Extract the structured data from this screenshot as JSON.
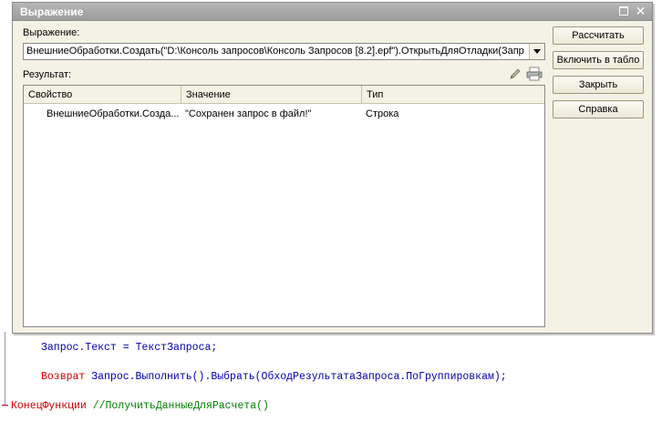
{
  "editor": {
    "line1": {
      "object": "Запрос",
      "property": "Текст",
      "op": " = ",
      "value": "ТекстЗапроса",
      "end": ";"
    },
    "line2": {
      "keyword": "Возврат",
      "call": "Запрос.Выполнить().Выбрать(ОбходРезультатаЗапроса.ПоГруппировкам);"
    },
    "line3": {
      "keyword": "КонецФункции",
      "comment": " //ПолучитьДанныеДляРасчета()"
    }
  },
  "dialog": {
    "title": "Выражение",
    "expression_label": "Выражение:",
    "expression_value": "ВнешниеОбработки.Создать(\"D:\\Консоль запросов\\Консоль Запросов [8.2].epf\").ОткрытьДляОтладки(Запр",
    "result_label": "Результат:",
    "icons": {
      "edit": "pencil-icon",
      "print": "print-icon"
    },
    "table": {
      "headers": [
        "Свойство",
        "Значение",
        "Тип"
      ],
      "rows": [
        {
          "property": "ВнешниеОбработки.Созда...",
          "value": "\"Сохранен запрос в файл!\"",
          "type": "Строка"
        }
      ]
    },
    "buttons": {
      "calculate": "Рассчитать",
      "include_in_table": "Включить в табло",
      "close": "Закрыть",
      "help": "Справка"
    }
  },
  "colors": {
    "keyword": "#cc0000",
    "identifier": "#0000aa",
    "comment": "#008000",
    "dialog_bg": "#f4f2e4",
    "titlebar": "#a9a9a9"
  }
}
